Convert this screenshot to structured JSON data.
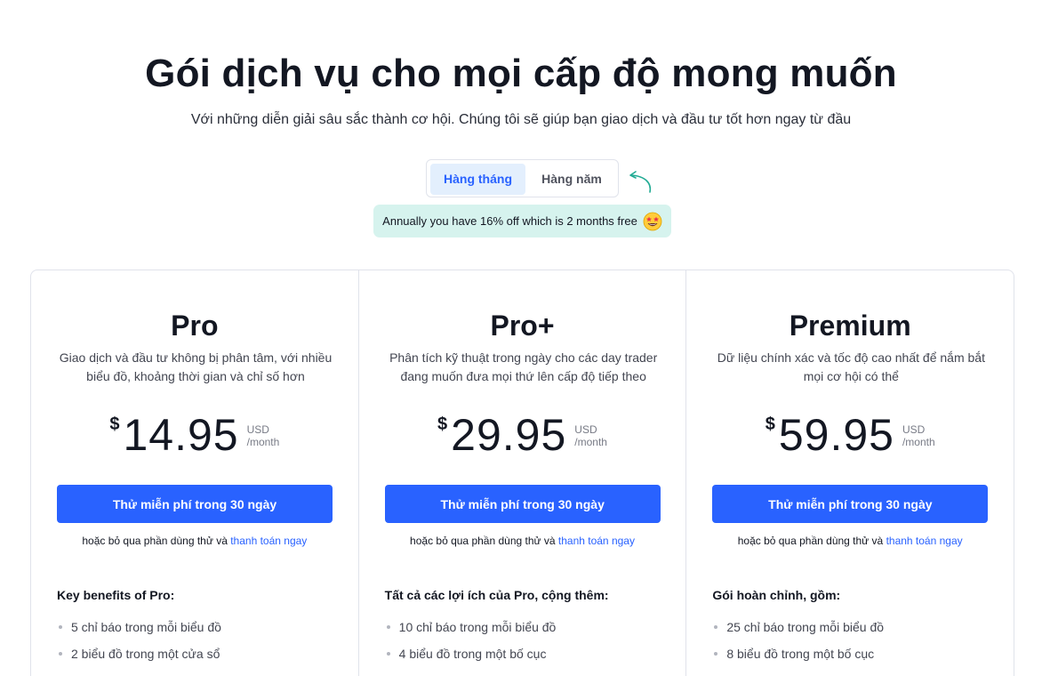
{
  "header": {
    "title": "Gói dịch vụ cho mọi cấp độ mong muốn",
    "subtitle": "Với những diễn giải sâu sắc thành cơ hội. Chúng tôi sẽ giúp bạn giao dịch và đầu tư tốt hơn ngay từ đầu"
  },
  "billing": {
    "monthly_label": "Hàng tháng",
    "yearly_label": "Hàng năm",
    "selected": "monthly",
    "discount_text": "Annually you have 16% off which is 2 months free",
    "discount_emoji": "star-struck-emoji-icon"
  },
  "plans": [
    {
      "name": "Pro",
      "description": "Giao dịch và đầu tư không bị phân tâm, với nhiều biểu đồ, khoảng thời gian và chỉ số hơn",
      "currency_symbol": "$",
      "price": "14.95",
      "currency": "USD",
      "period": "/month",
      "cta_label": "Thử miễn phí trong 30 ngày",
      "skip_text": "hoặc bỏ qua phần dùng thử và",
      "skip_link": "thanh toán ngay",
      "benefits_title": "Key benefits of Pro:",
      "benefits": [
        "5 chỉ báo trong mỗi biểu đồ",
        "2 biểu đồ trong một cửa sổ"
      ]
    },
    {
      "name": "Pro+",
      "description": "Phân tích kỹ thuật trong ngày cho các day trader đang muốn đưa mọi thứ lên cấp độ tiếp theo",
      "currency_symbol": "$",
      "price": "29.95",
      "currency": "USD",
      "period": "/month",
      "cta_label": "Thử miễn phí trong 30 ngày",
      "skip_text": "hoặc bỏ qua phần dùng thử và",
      "skip_link": "thanh toán ngay",
      "benefits_title": "Tất cả các lợi ích của Pro, cộng thêm:",
      "benefits": [
        "10 chỉ báo trong mỗi biểu đồ",
        "4 biểu đồ trong một bố cục"
      ]
    },
    {
      "name": "Premium",
      "description": "Dữ liệu chính xác và tốc độ cao nhất để nắm bắt mọi cơ hội có thể",
      "currency_symbol": "$",
      "price": "59.95",
      "currency": "USD",
      "period": "/month",
      "cta_label": "Thử miễn phí trong 30 ngày",
      "skip_text": "hoặc bỏ qua phần dùng thử và",
      "skip_link": "thanh toán ngay",
      "benefits_title": "Gói hoàn chỉnh, gồm:",
      "benefits": [
        "25 chỉ báo trong mỗi biểu đồ",
        "8 biểu đồ trong một bố cục"
      ]
    }
  ],
  "colors": {
    "accent": "#2962ff",
    "toggle_active_bg": "#e3effd",
    "badge_bg": "#d6f3ee",
    "arrow": "#22ab94"
  }
}
